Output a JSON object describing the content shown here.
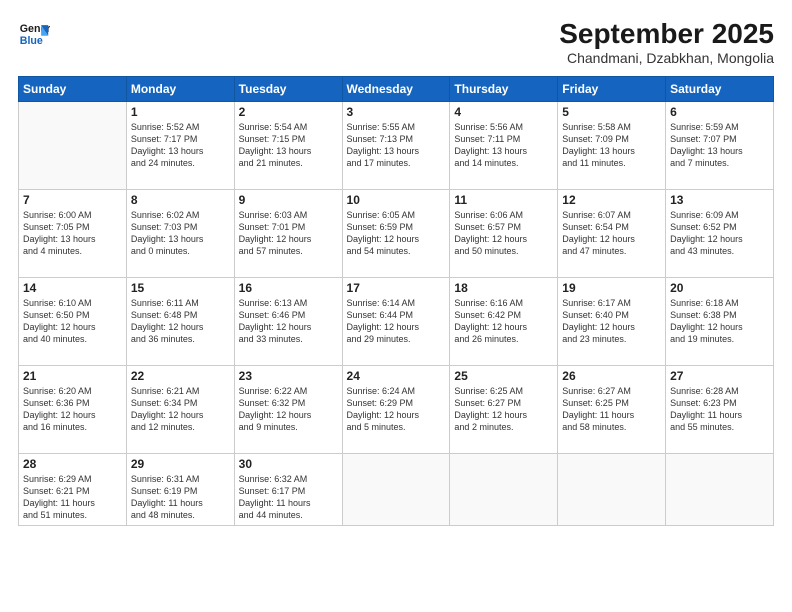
{
  "logo": {
    "line1": "General",
    "line2": "Blue"
  },
  "title": "September 2025",
  "location": "Chandmani, Dzabkhan, Mongolia",
  "weekdays": [
    "Sunday",
    "Monday",
    "Tuesday",
    "Wednesday",
    "Thursday",
    "Friday",
    "Saturday"
  ],
  "weeks": [
    [
      {
        "day": "",
        "info": ""
      },
      {
        "day": "1",
        "info": "Sunrise: 5:52 AM\nSunset: 7:17 PM\nDaylight: 13 hours\nand 24 minutes."
      },
      {
        "day": "2",
        "info": "Sunrise: 5:54 AM\nSunset: 7:15 PM\nDaylight: 13 hours\nand 21 minutes."
      },
      {
        "day": "3",
        "info": "Sunrise: 5:55 AM\nSunset: 7:13 PM\nDaylight: 13 hours\nand 17 minutes."
      },
      {
        "day": "4",
        "info": "Sunrise: 5:56 AM\nSunset: 7:11 PM\nDaylight: 13 hours\nand 14 minutes."
      },
      {
        "day": "5",
        "info": "Sunrise: 5:58 AM\nSunset: 7:09 PM\nDaylight: 13 hours\nand 11 minutes."
      },
      {
        "day": "6",
        "info": "Sunrise: 5:59 AM\nSunset: 7:07 PM\nDaylight: 13 hours\nand 7 minutes."
      }
    ],
    [
      {
        "day": "7",
        "info": "Sunrise: 6:00 AM\nSunset: 7:05 PM\nDaylight: 13 hours\nand 4 minutes."
      },
      {
        "day": "8",
        "info": "Sunrise: 6:02 AM\nSunset: 7:03 PM\nDaylight: 13 hours\nand 0 minutes."
      },
      {
        "day": "9",
        "info": "Sunrise: 6:03 AM\nSunset: 7:01 PM\nDaylight: 12 hours\nand 57 minutes."
      },
      {
        "day": "10",
        "info": "Sunrise: 6:05 AM\nSunset: 6:59 PM\nDaylight: 12 hours\nand 54 minutes."
      },
      {
        "day": "11",
        "info": "Sunrise: 6:06 AM\nSunset: 6:57 PM\nDaylight: 12 hours\nand 50 minutes."
      },
      {
        "day": "12",
        "info": "Sunrise: 6:07 AM\nSunset: 6:54 PM\nDaylight: 12 hours\nand 47 minutes."
      },
      {
        "day": "13",
        "info": "Sunrise: 6:09 AM\nSunset: 6:52 PM\nDaylight: 12 hours\nand 43 minutes."
      }
    ],
    [
      {
        "day": "14",
        "info": "Sunrise: 6:10 AM\nSunset: 6:50 PM\nDaylight: 12 hours\nand 40 minutes."
      },
      {
        "day": "15",
        "info": "Sunrise: 6:11 AM\nSunset: 6:48 PM\nDaylight: 12 hours\nand 36 minutes."
      },
      {
        "day": "16",
        "info": "Sunrise: 6:13 AM\nSunset: 6:46 PM\nDaylight: 12 hours\nand 33 minutes."
      },
      {
        "day": "17",
        "info": "Sunrise: 6:14 AM\nSunset: 6:44 PM\nDaylight: 12 hours\nand 29 minutes."
      },
      {
        "day": "18",
        "info": "Sunrise: 6:16 AM\nSunset: 6:42 PM\nDaylight: 12 hours\nand 26 minutes."
      },
      {
        "day": "19",
        "info": "Sunrise: 6:17 AM\nSunset: 6:40 PM\nDaylight: 12 hours\nand 23 minutes."
      },
      {
        "day": "20",
        "info": "Sunrise: 6:18 AM\nSunset: 6:38 PM\nDaylight: 12 hours\nand 19 minutes."
      }
    ],
    [
      {
        "day": "21",
        "info": "Sunrise: 6:20 AM\nSunset: 6:36 PM\nDaylight: 12 hours\nand 16 minutes."
      },
      {
        "day": "22",
        "info": "Sunrise: 6:21 AM\nSunset: 6:34 PM\nDaylight: 12 hours\nand 12 minutes."
      },
      {
        "day": "23",
        "info": "Sunrise: 6:22 AM\nSunset: 6:32 PM\nDaylight: 12 hours\nand 9 minutes."
      },
      {
        "day": "24",
        "info": "Sunrise: 6:24 AM\nSunset: 6:29 PM\nDaylight: 12 hours\nand 5 minutes."
      },
      {
        "day": "25",
        "info": "Sunrise: 6:25 AM\nSunset: 6:27 PM\nDaylight: 12 hours\nand 2 minutes."
      },
      {
        "day": "26",
        "info": "Sunrise: 6:27 AM\nSunset: 6:25 PM\nDaylight: 11 hours\nand 58 minutes."
      },
      {
        "day": "27",
        "info": "Sunrise: 6:28 AM\nSunset: 6:23 PM\nDaylight: 11 hours\nand 55 minutes."
      }
    ],
    [
      {
        "day": "28",
        "info": "Sunrise: 6:29 AM\nSunset: 6:21 PM\nDaylight: 11 hours\nand 51 minutes."
      },
      {
        "day": "29",
        "info": "Sunrise: 6:31 AM\nSunset: 6:19 PM\nDaylight: 11 hours\nand 48 minutes."
      },
      {
        "day": "30",
        "info": "Sunrise: 6:32 AM\nSunset: 6:17 PM\nDaylight: 11 hours\nand 44 minutes."
      },
      {
        "day": "",
        "info": ""
      },
      {
        "day": "",
        "info": ""
      },
      {
        "day": "",
        "info": ""
      },
      {
        "day": "",
        "info": ""
      }
    ]
  ]
}
